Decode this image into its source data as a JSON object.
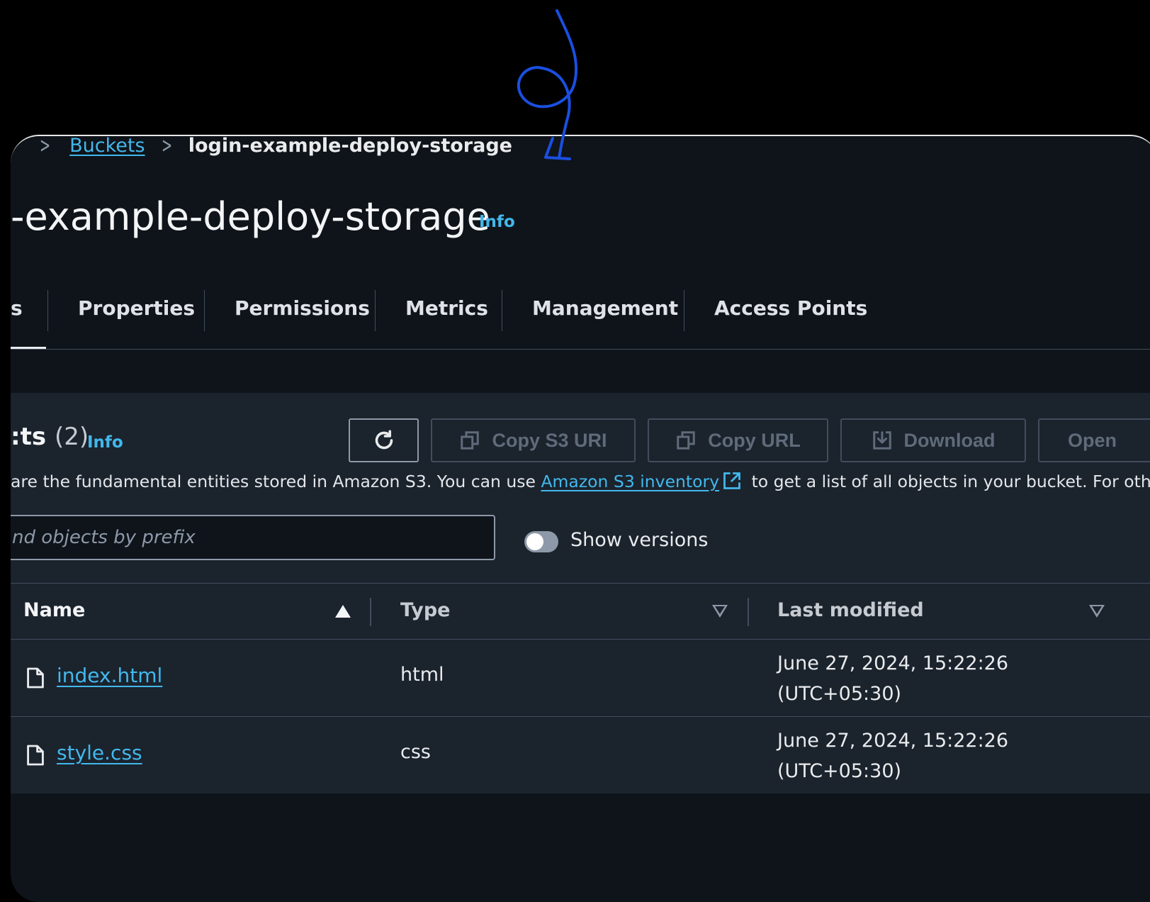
{
  "breadcrumb": {
    "buckets_label": "Buckets",
    "current_label": "login-example-deploy-storage"
  },
  "header": {
    "title": "-example-deploy-storage",
    "info_label": "Info"
  },
  "tabs": [
    {
      "label": "s",
      "active": true
    },
    {
      "label": "Properties"
    },
    {
      "label": "Permissions"
    },
    {
      "label": "Metrics"
    },
    {
      "label": "Management"
    },
    {
      "label": "Access Points"
    }
  ],
  "objects": {
    "heading": ":ts",
    "count": "(2)",
    "info_label": "Info",
    "toolbar": {
      "copy_s3_uri": "Copy S3 URI",
      "copy_url": "Copy URL",
      "download": "Download",
      "open": "Open"
    },
    "description_before": "are the fundamental entities stored in Amazon S3. You can use ",
    "description_link": "Amazon S3 inventory",
    "description_after": " to get a list of all objects in your bucket. For others to",
    "search_placeholder": "nd objects by prefix",
    "show_versions_label": "Show versions",
    "show_versions_on": false,
    "columns": {
      "name": "Name",
      "type": "Type",
      "last_modified": "Last modified"
    },
    "rows": [
      {
        "name": "index.html",
        "type": "html",
        "date": "June 27, 2024, 15:22:26",
        "tz": "(UTC+05:30)"
      },
      {
        "name": "style.css",
        "type": "css",
        "date": "June 27, 2024, 15:22:26",
        "tz": "(UTC+05:30)"
      }
    ]
  },
  "colors": {
    "page_bg": "#000000",
    "panel_bg": "#0f141a",
    "card_bg": "#1b232d",
    "link": "#42b8ec",
    "annotation_arrow": "#1a4fe0"
  },
  "icons": [
    "chevron-right-icon",
    "refresh-icon",
    "copy-icon",
    "download-icon",
    "external-link-icon",
    "file-icon",
    "sort-ascending-icon",
    "sort-descending-icon",
    "hand-drawn-arrow"
  ]
}
